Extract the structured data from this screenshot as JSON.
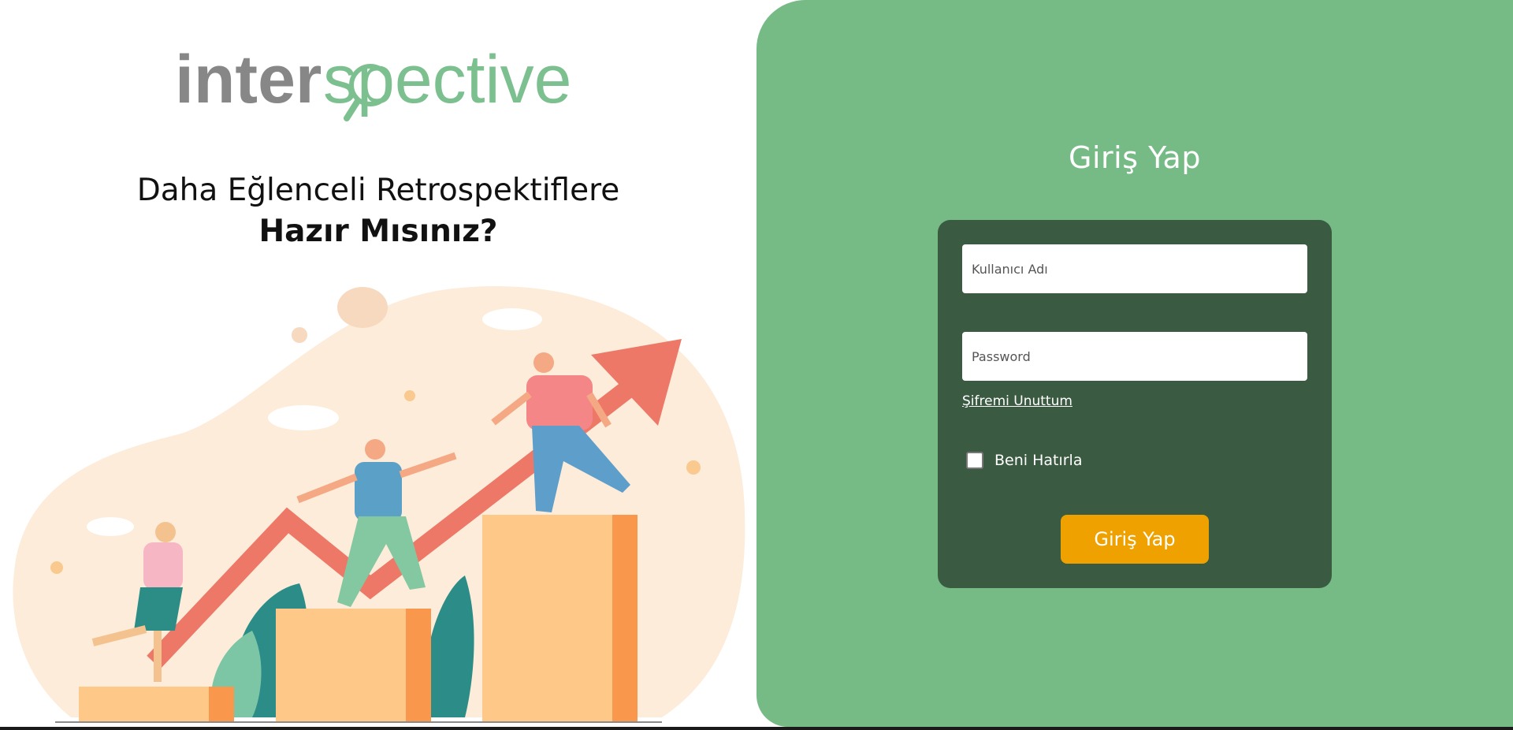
{
  "brand": {
    "logo_part1": "inter",
    "logo_part2": "spective",
    "logo_color_dark": "#878787",
    "logo_color_green": "#7cc08f"
  },
  "hero": {
    "tagline_line1": "Daha Eğlenceli Retrospektiflere",
    "tagline_line2": "Hazır Mısınız?"
  },
  "login": {
    "title": "Giriş Yap",
    "username_placeholder": "Kullanıcı Adı",
    "password_placeholder": "Password",
    "forgot_link": "Şifremi Unuttum",
    "remember_label": "Beni Hatırla",
    "remember_checked": false,
    "submit_label": "Giriş Yap"
  },
  "colors": {
    "panel_bg": "#76ba86",
    "card_bg": "#3b5a42",
    "button_bg": "#efa100"
  }
}
